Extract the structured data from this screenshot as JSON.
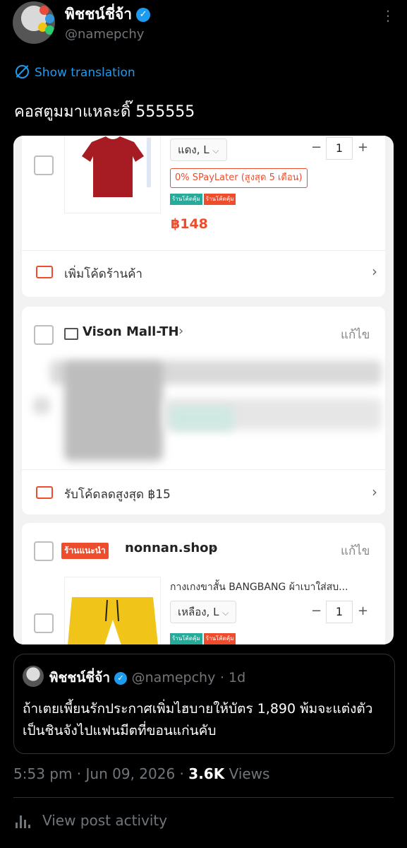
{
  "author": {
    "name": "พิชชน์ชี่จ้า",
    "handle": "@namepchy"
  },
  "translate_label": "Show translation",
  "post_text": "คอสตูมมาแหละดิ๊ 555555",
  "screenshot": {
    "item1": {
      "variant": "แดง, L",
      "qty": "1",
      "spaylater": "0% SPayLater (สูงสุด 5 เดือน)",
      "tag1": "ร้านโค้ดคุ้ม",
      "tag2": "ร้านโค้ดคุ้ม",
      "price": "฿148"
    },
    "shop_code_row": "เพิ่มโค้ดร้านค้า",
    "shop2": {
      "name": "Vison Mall-TH",
      "edit": "แก้ไข",
      "discount": "รับโค้ดลดสูงสุด ฿15"
    },
    "shop3": {
      "badge": "ร้านแนะนำ",
      "name": "nonnan.shop",
      "edit": "แก้ไข",
      "product": "กางเกงขาสั้น BANGBANG ผ้าเบาใส่สบ...",
      "variant": "เหลือง, L",
      "qty": "1",
      "tag1": "ร้านโค้ดคุ้ม",
      "tag2": "ร้านโค้ดคุ้ม"
    }
  },
  "quote": {
    "name": "พิชชน์ชี่จ้า",
    "handle": "@namepchy",
    "time": "· 1d",
    "text": "ถ้าเตยเพี้ยนรักประกาศเพิ่มไฮบายให้บัตร 1,890 พ้มจะแต่งตัวเป็นชินจังไปแฟนมีตที่ขอนแก่นคับ"
  },
  "meta": {
    "time": "5:53 pm",
    "date": "Jun 09, 2026",
    "views": "3.6K",
    "views_label": "Views"
  },
  "activity_label": "View post activity",
  "colors": {
    "accent": "#1d9bf0",
    "shopee": "#ee4d2d",
    "background": "#000000"
  }
}
